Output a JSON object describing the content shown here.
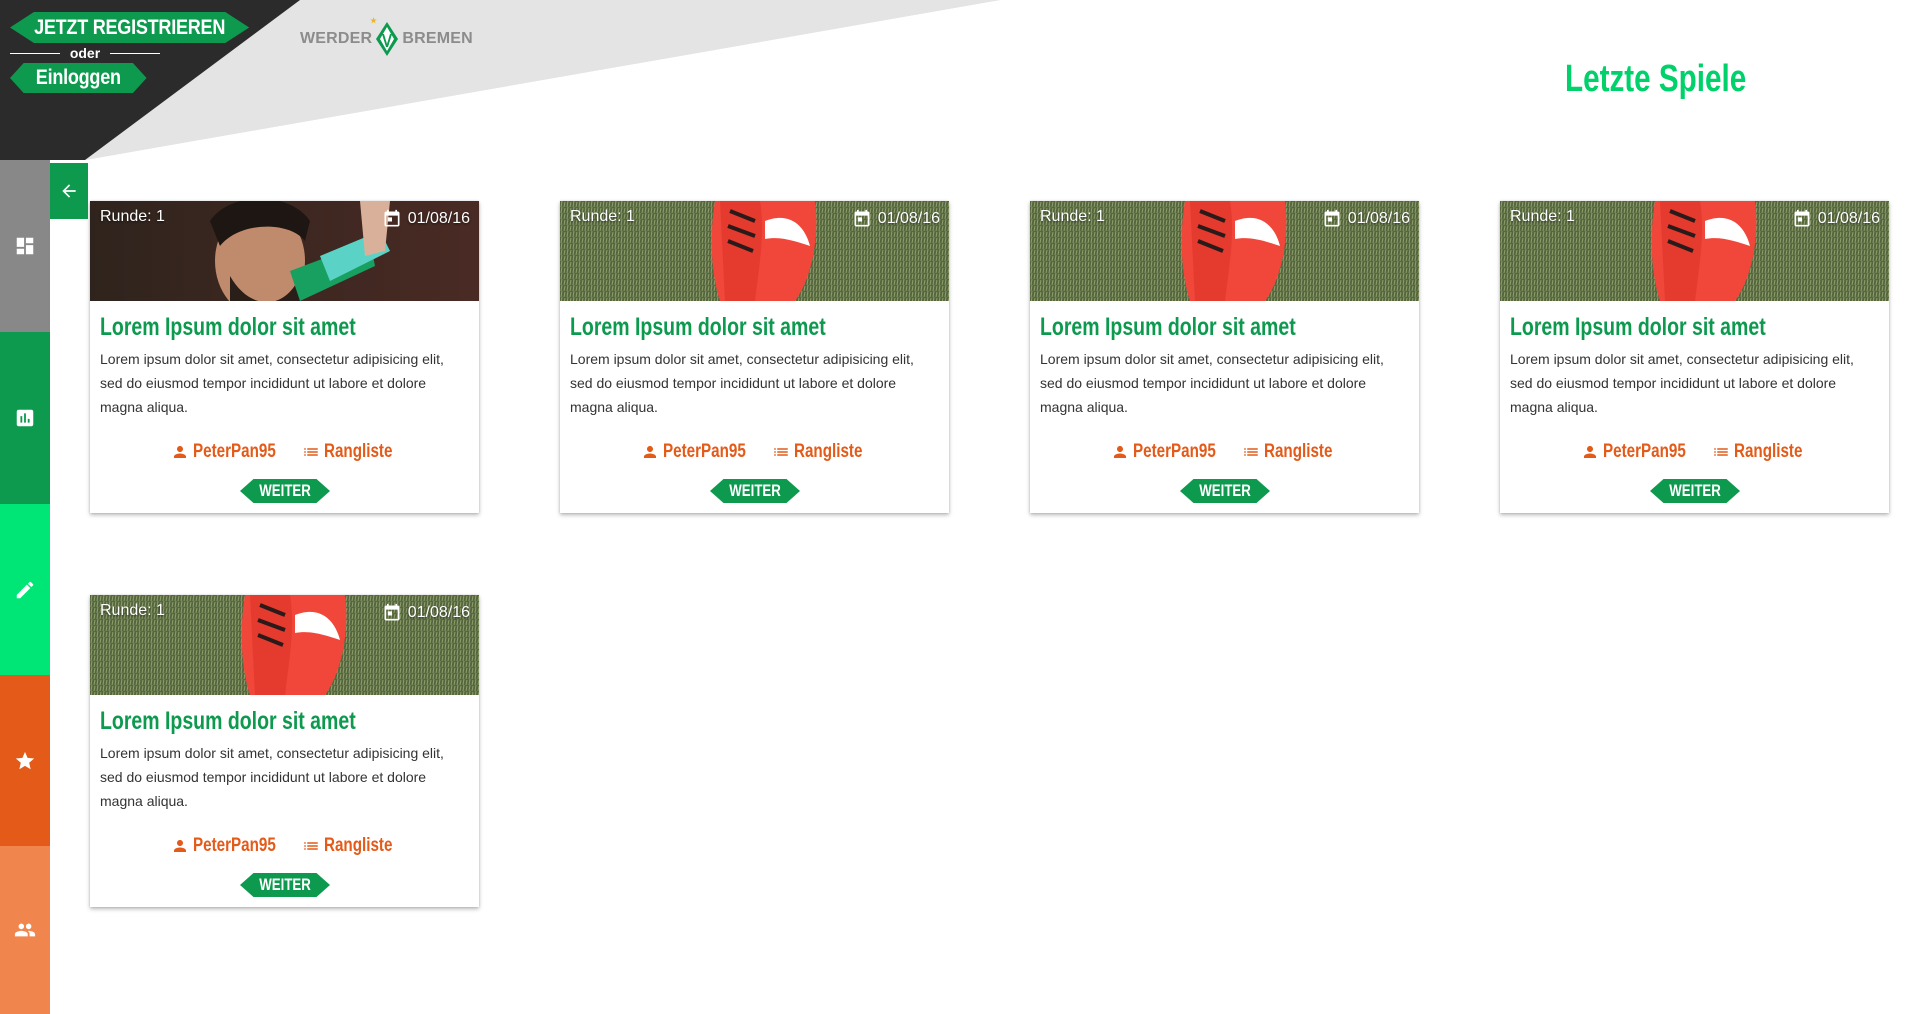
{
  "auth": {
    "register_label": "JETZT REGISTRIEREN",
    "or_label": "oder",
    "login_label": "Einloggen"
  },
  "logo": {
    "left_text": "WERDER",
    "right_text": "BREMEN"
  },
  "page_title": "Letzte Spiele",
  "colors": {
    "accent_green": "#0d9a4f",
    "title_green": "#00d16b",
    "orange": "#e35a19",
    "dark": "#2b2b2b"
  },
  "sidebar": {
    "items": [
      {
        "icon": "dashboard-icon",
        "color": "#888888"
      },
      {
        "icon": "bar-chart-icon",
        "color": "#0d9a4f"
      },
      {
        "icon": "pencil-icon",
        "color": "#00e676"
      },
      {
        "icon": "star-icon",
        "color": "#e35a19"
      },
      {
        "icon": "people-icon",
        "color": "#f0854d"
      }
    ],
    "collapse_icon": "arrow-left-icon"
  },
  "cards": [
    {
      "round": "Runde: 1",
      "date": "01/08/16",
      "image": "player-photo",
      "title": "Lorem Ipsum dolor sit amet",
      "text": "Lorem ipsum dolor sit amet, consectetur adipisicing elit, sed do eiusmod tempor incididunt ut labore et dolore magna aliqua.",
      "user": "PeterPan95",
      "ranking": "Rangliste",
      "button": "WEITER"
    },
    {
      "round": "Runde: 1",
      "date": "01/08/16",
      "image": "football-boot-photo",
      "title": "Lorem Ipsum dolor sit amet",
      "text": "Lorem ipsum dolor sit amet, consectetur adipisicing elit, sed do eiusmod tempor incididunt ut labore et dolore magna aliqua.",
      "user": "PeterPan95",
      "ranking": "Rangliste",
      "button": "WEITER"
    },
    {
      "round": "Runde: 1",
      "date": "01/08/16",
      "image": "football-boot-photo",
      "title": "Lorem Ipsum dolor sit amet",
      "text": "Lorem ipsum dolor sit amet, consectetur adipisicing elit, sed do eiusmod tempor incididunt ut labore et dolore magna aliqua.",
      "user": "PeterPan95",
      "ranking": "Rangliste",
      "button": "WEITER"
    },
    {
      "round": "Runde: 1",
      "date": "01/08/16",
      "image": "football-boot-photo",
      "title": "Lorem Ipsum dolor sit amet",
      "text": "Lorem ipsum dolor sit amet, consectetur adipisicing elit, sed do eiusmod tempor incididunt ut labore et dolore magna aliqua.",
      "user": "PeterPan95",
      "ranking": "Rangliste",
      "button": "WEITER"
    },
    {
      "round": "Runde: 1",
      "date": "01/08/16",
      "image": "football-boot-photo",
      "title": "Lorem Ipsum dolor sit amet",
      "text": "Lorem ipsum dolor sit amet, consectetur adipisicing elit, sed do eiusmod tempor incididunt ut labore et dolore magna aliqua.",
      "user": "PeterPan95",
      "ranking": "Rangliste",
      "button": "WEITER"
    }
  ]
}
